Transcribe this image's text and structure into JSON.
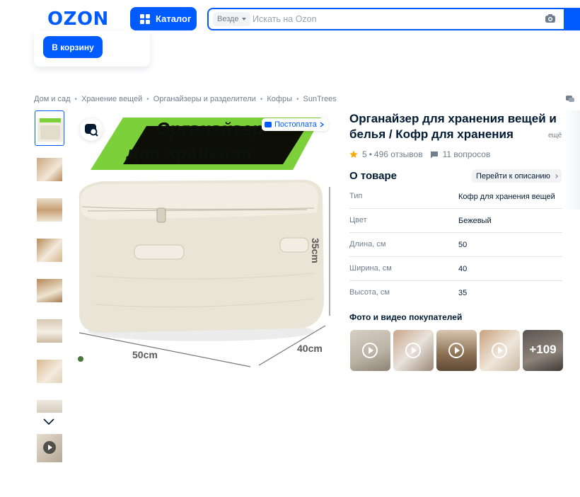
{
  "header": {
    "logo": "OZON",
    "catalog_label": "Каталог",
    "search_scope": "Везде",
    "search_placeholder": "Искать на Ozon"
  },
  "floating_card": {
    "cart_button": "В корзину"
  },
  "breadcrumb": [
    "Дом и сад",
    "Хранение вещей",
    "Органайзеры и разделители",
    "Кофры",
    "SunTrees"
  ],
  "gallery": {
    "banner_line_1": "Органайзер",
    "banner_line_2": "для хранения",
    "dim_width": "50cm",
    "dim_depth": "40cm",
    "dim_height": "35cm",
    "badge": "Постоплата",
    "thumbnail_count": 9
  },
  "product": {
    "title": "Органайзер для хранения вещей и белья / Кофр для хранения",
    "title_more": "ещё",
    "rating": "5",
    "reviews": "496 отзывов",
    "questions": "11 вопросов",
    "about_heading": "О товаре",
    "goto_description": "Перейти к описанию",
    "specs": [
      {
        "key": "Тип",
        "value": "Кофр для хранения вещей"
      },
      {
        "key": "Цвет",
        "value": "Бежевый"
      },
      {
        "key": "Длина, см",
        "value": "50"
      },
      {
        "key": "Ширина, см",
        "value": "40"
      },
      {
        "key": "Высота, см",
        "value": "35"
      }
    ],
    "ugc_heading": "Фото и видео покупателей",
    "ugc_more": "+109"
  },
  "colors": {
    "brand_blue": "#005bff",
    "banner_green": "#7cd13a",
    "rating_star": "#ffa800"
  }
}
